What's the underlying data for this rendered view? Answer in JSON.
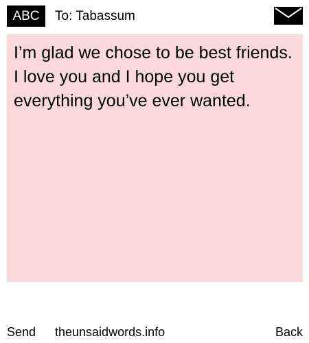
{
  "header": {
    "mode": "ABC",
    "recipient": "To: Tabassum",
    "icon": "envelope-icon"
  },
  "message": {
    "text": "I’m glad we chose to be best friends. I love you and I hope you get everything you’ve ever wanted.",
    "background_color": "#f9d9dd"
  },
  "footer": {
    "send_label": "Send",
    "site": "theunsaidwords.info",
    "back_label": "Back"
  }
}
